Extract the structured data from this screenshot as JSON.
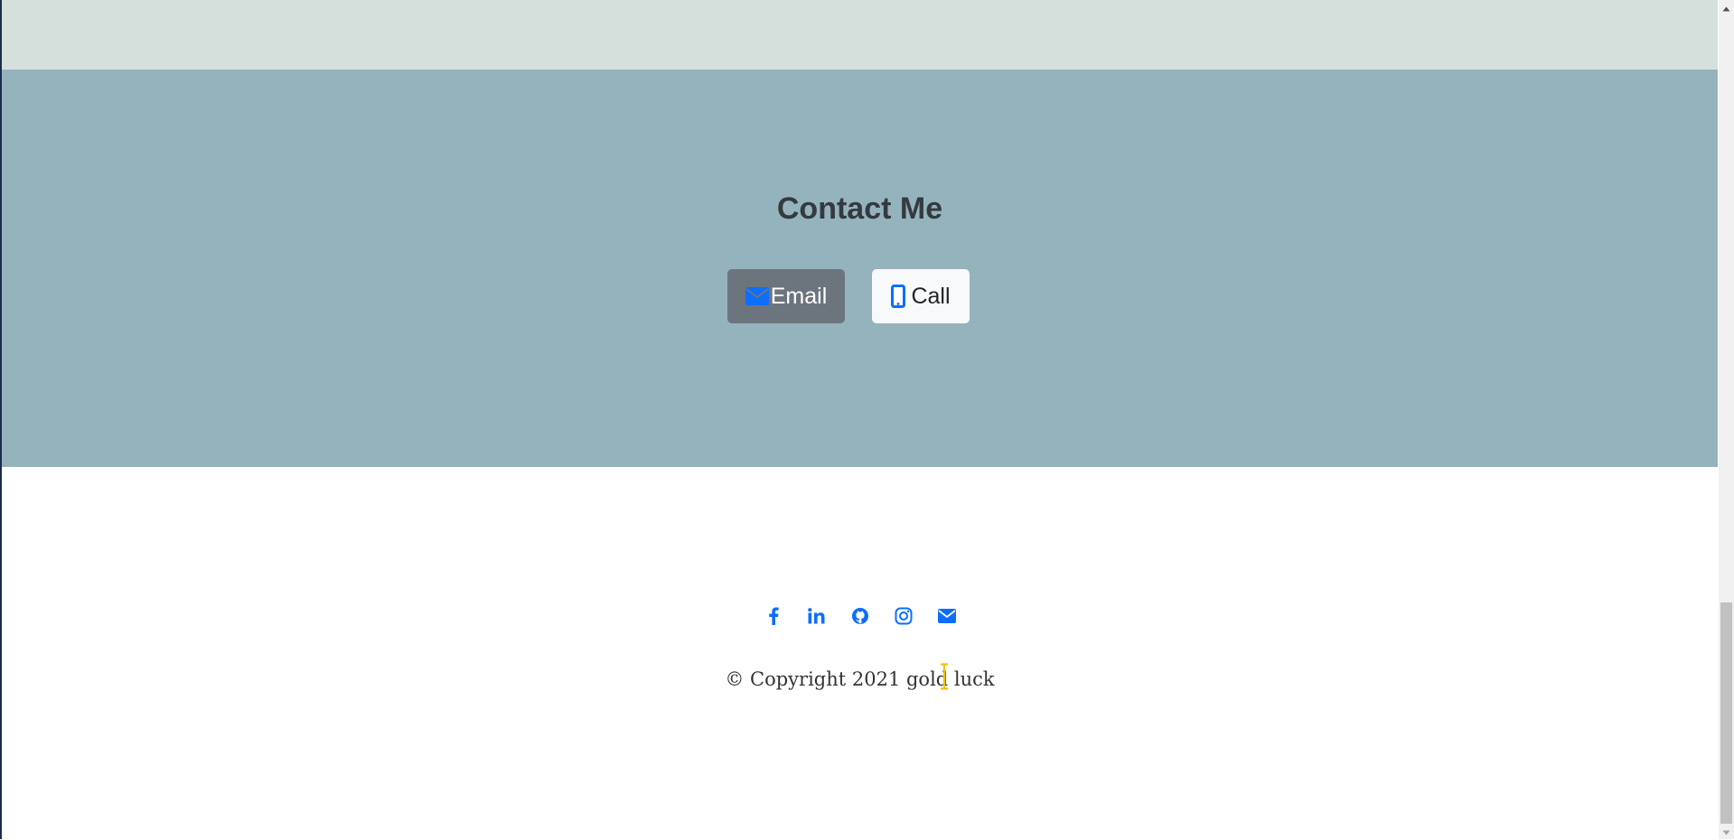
{
  "contact": {
    "title": "Contact Me",
    "email_label": "Email",
    "call_label": "Call"
  },
  "social": {
    "icons": [
      "facebook-icon",
      "linkedin-icon",
      "github-icon",
      "instagram-icon",
      "envelope-icon"
    ]
  },
  "footer": {
    "copyright": "© Copyright 2021 gold luck"
  },
  "colors": {
    "top_band": "#d5e0dd",
    "contact_bg": "#95b3bd",
    "title": "#343a40",
    "email_button": "#6c757d",
    "call_button": "#f8f9fa",
    "icon_accent": "#0d6efd",
    "text_cursor": "#f2c200"
  }
}
